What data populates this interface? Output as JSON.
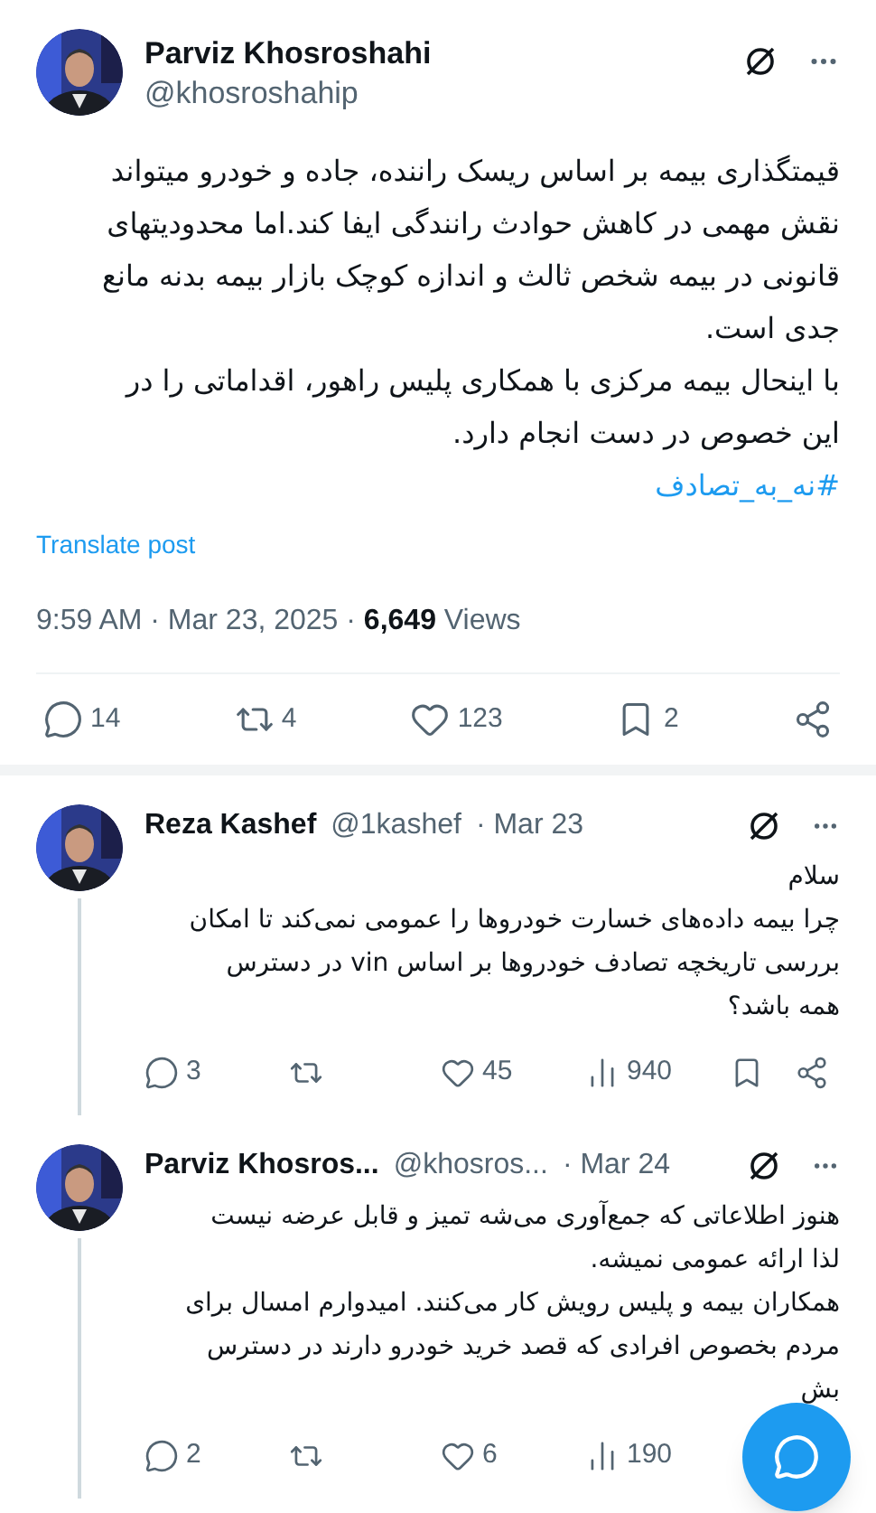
{
  "post": {
    "author": "Parviz Khosroshahi",
    "handle": "@khosroshahip",
    "text": "قیمتگذاری بیمه بر اساس ریسک راننده، جاده و خودرو میتواند\nنقش مهمی در کاهش حوادث رانندگی ایفا کند.اما محدودیتهای\nقانونی در بیمه شخص ثالث و اندازه کوچک بازار بیمه بدنه مانع\nجدی است.\nبا اینحال بیمه مرکزی با همکاری پلیس راهور، اقداماتی را در\nاین خصوص در دست انجام دارد.",
    "hashtag": "#نه_به_تصادف",
    "translate": "Translate post",
    "time": "9:59 AM · Mar 23, 2025 · ",
    "views": "6,649",
    "views_label": " Views",
    "actions": [
      {
        "kind": "reply"
      },
      {
        "kind": "repost"
      },
      {
        "kind": "like"
      },
      {
        "kind": "bookmark"
      },
      {
        "kind": "share"
      }
    ],
    "counts": {
      "reply": "14",
      "repost": "4",
      "like": "123",
      "bookmark": "2"
    }
  },
  "replies": [
    {
      "author": "Reza Kashef",
      "handle": "@1kashef",
      "date": "· Mar 23",
      "text": "سلام\nچرا بیمه داده‌های خسارت خودروها را عمومی نمی‌کند تا امکان\nبررسی تاریخچه تصادف خودروها بر اساس vin در دسترس\nهمه باشد؟",
      "actions": [
        {
          "kind": "reply"
        },
        {
          "kind": "repost"
        },
        {
          "kind": "like"
        },
        {
          "kind": "views"
        },
        {
          "kind": "bookmark"
        },
        {
          "kind": "share"
        }
      ],
      "counts": {
        "reply": "3",
        "like": "45",
        "views": "940"
      }
    },
    {
      "author": "Parviz Khosros...",
      "handle": "@khosros...",
      "date": "· Mar 24",
      "text": "هنوز اطلاعاتی که جمع‌آوری می‌شه تمیز و قابل عرضه نیست\nلذا ارائه عمومی نمیشه.\nهمکاران بیمه و پلیس رویش کار می‌کنند. امیدوارم امسال برای\nمردم بخصوص افرادی که قصد خرید خودرو دارند در دسترس\nبش",
      "actions": [
        {
          "kind": "reply"
        },
        {
          "kind": "repost"
        },
        {
          "kind": "like"
        },
        {
          "kind": "views"
        }
      ],
      "counts": {
        "reply": "2",
        "like": "6",
        "views": "190"
      }
    }
  ]
}
